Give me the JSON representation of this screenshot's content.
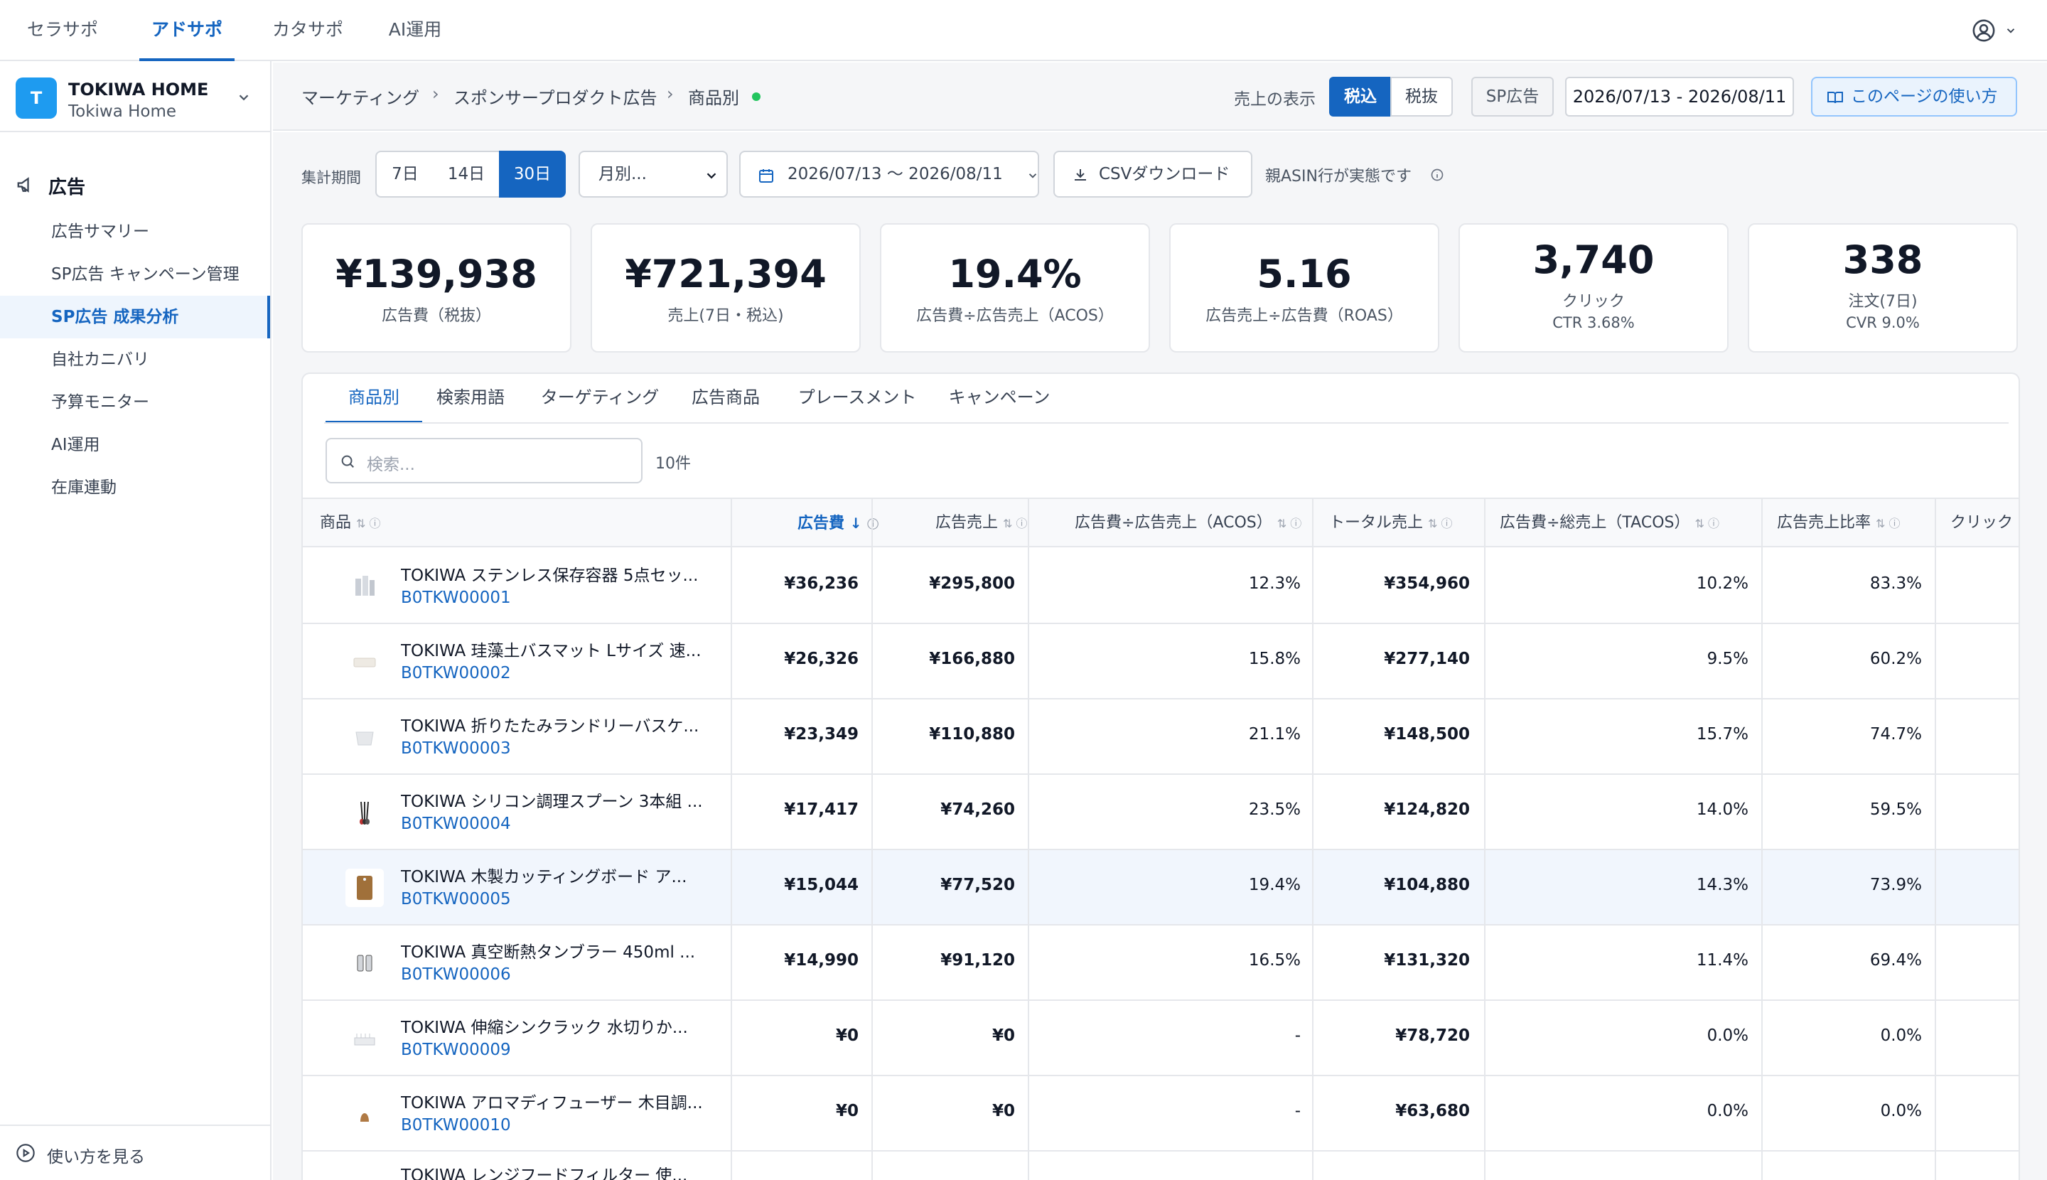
{
  "topnav": {
    "tabs": [
      {
        "label": "セラサポ"
      },
      {
        "label": "アドサポ"
      },
      {
        "label": "カタサポ"
      },
      {
        "label": "AI運用"
      }
    ]
  },
  "store": {
    "initial": "T",
    "name": "TOKIWA HOME",
    "sub": "Tokiwa Home"
  },
  "sidebar": {
    "section": "広告",
    "items": [
      {
        "label": "広告サマリー"
      },
      {
        "label": "SP広告 キャンペーン管理"
      },
      {
        "label": "SP広告 成果分析"
      },
      {
        "label": "自社カニバリ"
      },
      {
        "label": "予算モニター"
      },
      {
        "label": "AI運用"
      },
      {
        "label": "在庫連動"
      }
    ],
    "footer": "使い方を見る"
  },
  "header": {
    "breadcrumb": [
      "マーケティング",
      "スポンサープロダクト広告",
      "商品別"
    ],
    "sales_display_label": "売上の表示",
    "tax_in": "税込",
    "tax_out": "税抜",
    "ad_type": "SP広告",
    "date_range": "2026/07/13 - 2026/08/11",
    "howto": "このページの使い方"
  },
  "controls": {
    "period_label": "集計期間",
    "periods": [
      "7日",
      "14日",
      "30日"
    ],
    "granularity": "月別...",
    "date_range": "2026/07/13 〜 2026/08/11",
    "csv": "CSVダウンロード",
    "note": "親ASIN行が実態です"
  },
  "kpis": [
    {
      "value": "¥139,938",
      "label": "広告費（税抜）",
      "sub": ""
    },
    {
      "value": "¥721,394",
      "label": "売上(7日・税込)",
      "sub": ""
    },
    {
      "value": "19.4%",
      "label": "広告費÷広告売上（ACOS）",
      "sub": ""
    },
    {
      "value": "5.16",
      "label": "広告売上÷広告費（ROAS）",
      "sub": ""
    },
    {
      "value": "3,740",
      "label": "クリック",
      "sub": "CTR 3.68%"
    },
    {
      "value": "338",
      "label": "注文(7日)",
      "sub": "CVR 9.0%"
    }
  ],
  "table": {
    "tabs": [
      "商品別",
      "検索用語",
      "ターゲティング",
      "広告商品",
      "プレースメント",
      "キャンペーン"
    ],
    "search_placeholder": "検索...",
    "count": "10件",
    "columns": [
      "商品",
      "広告費",
      "広告売上",
      "広告費÷広告売上（ACOS）",
      "トータル売上",
      "広告費÷総売上（TACOS）",
      "広告売上比率",
      "クリック"
    ],
    "rows": [
      {
        "name": "TOKIWA ステンレス保存容器 5点セッ...",
        "asin": "B0TKW00001",
        "spend": "¥36,236",
        "sales": "¥295,800",
        "acos": "12.3%",
        "total": "¥354,960",
        "tacos": "10.2%",
        "ratio": "83.3%"
      },
      {
        "name": "TOKIWA 珪藻土バスマット Lサイズ 速...",
        "asin": "B0TKW00002",
        "spend": "¥26,326",
        "sales": "¥166,880",
        "acos": "15.8%",
        "total": "¥277,140",
        "tacos": "9.5%",
        "ratio": "60.2%"
      },
      {
        "name": "TOKIWA 折りたたみランドリーバスケ...",
        "asin": "B0TKW00003",
        "spend": "¥23,349",
        "sales": "¥110,880",
        "acos": "21.1%",
        "total": "¥148,500",
        "tacos": "15.7%",
        "ratio": "74.7%"
      },
      {
        "name": "TOKIWA シリコン調理スプーン 3本組 ...",
        "asin": "B0TKW00004",
        "spend": "¥17,417",
        "sales": "¥74,260",
        "acos": "23.5%",
        "total": "¥124,820",
        "tacos": "14.0%",
        "ratio": "59.5%"
      },
      {
        "name": "TOKIWA 木製カッティングボード ア...",
        "asin": "B0TKW00005",
        "spend": "¥15,044",
        "sales": "¥77,520",
        "acos": "19.4%",
        "total": "¥104,880",
        "tacos": "14.3%",
        "ratio": "73.9%"
      },
      {
        "name": "TOKIWA 真空断熱タンブラー 450ml ...",
        "asin": "B0TKW00006",
        "spend": "¥14,990",
        "sales": "¥91,120",
        "acos": "16.5%",
        "total": "¥131,320",
        "tacos": "11.4%",
        "ratio": "69.4%"
      },
      {
        "name": "TOKIWA 伸縮シンクラック 水切りか...",
        "asin": "B0TKW00009",
        "spend": "¥0",
        "sales": "¥0",
        "acos": "-",
        "total": "¥78,720",
        "tacos": "0.0%",
        "ratio": "0.0%"
      },
      {
        "name": "TOKIWA アロマディフューザー 木目調...",
        "asin": "B0TKW00010",
        "spend": "¥0",
        "sales": "¥0",
        "acos": "-",
        "total": "¥63,680",
        "tacos": "0.0%",
        "ratio": "0.0%"
      },
      {
        "name": "TOKIWA レンジフードフィルター 使...",
        "asin": "",
        "spend": "",
        "sales": "",
        "acos": "",
        "total": "",
        "tacos": "",
        "ratio": ""
      }
    ]
  },
  "colors": {
    "accent": "#1565c0",
    "status_dot": "#22c55e",
    "highlight_row": "#f1f6fd"
  }
}
